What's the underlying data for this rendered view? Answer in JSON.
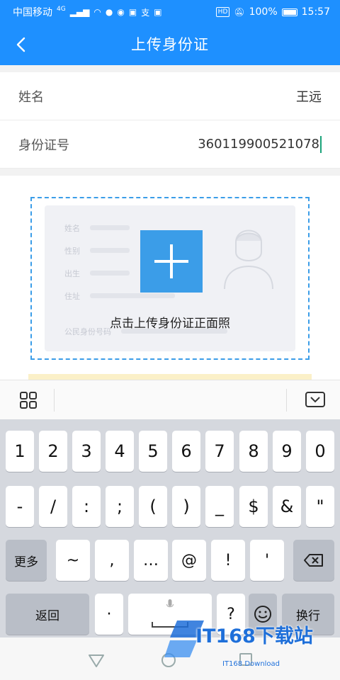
{
  "status_bar": {
    "carrier": "中国移动",
    "network": "4G",
    "battery": "100%",
    "time": "15:57",
    "hd_badge": "HD",
    "icons": [
      "signal-icon",
      "wifi-icon",
      "message-icon",
      "wechat-icon",
      "news-icon",
      "alipay-icon",
      "notification-icon",
      "mute-icon",
      "battery-icon"
    ]
  },
  "nav": {
    "title": "上传身份证",
    "back_icon": "chevron-left-icon"
  },
  "form": {
    "name_label": "姓名",
    "name_value": "王远",
    "id_label": "身份证号",
    "id_value": "360119900521078"
  },
  "upload": {
    "hint": "点击上传身份证正面照",
    "sample_fields": [
      "姓名",
      "性别",
      "出生",
      "住址",
      "公民身份号码"
    ],
    "accent": "#3b9de8"
  },
  "keyboard_toolbar": {
    "menu_icon": "grid-icon",
    "hide_icon": "keyboard-hide-icon"
  },
  "keyboard": {
    "row1": [
      "1",
      "2",
      "3",
      "4",
      "5",
      "6",
      "7",
      "8",
      "9",
      "0"
    ],
    "row2": [
      "-",
      "/",
      ":",
      ";",
      "(",
      ")",
      "_",
      "$",
      "&",
      "\""
    ],
    "row3": {
      "more": "更多",
      "keys": [
        "~",
        ",",
        "…",
        "@",
        "!",
        "'"
      ],
      "backspace_icon": "backspace-icon"
    },
    "row4": {
      "back": "返回",
      "dot": "·",
      "question": "?",
      "emoji_icon": "emoji-icon",
      "enter": "换行"
    }
  },
  "watermark": {
    "text": "IT168下载站",
    "sub": "IT168 Download"
  },
  "colors": {
    "primary": "#1e90ff",
    "caret": "#1aa37a"
  }
}
